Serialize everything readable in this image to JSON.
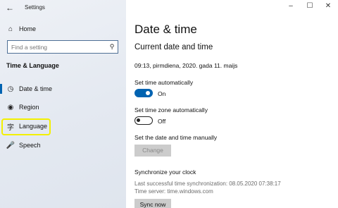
{
  "window": {
    "title": "Settings"
  },
  "sidebar": {
    "home": "Home",
    "search_placeholder": "Find a setting",
    "section_title": "Time & Language",
    "items": [
      {
        "label": "Date & time"
      },
      {
        "label": "Region"
      },
      {
        "label": "Language"
      },
      {
        "label": "Speech"
      }
    ]
  },
  "main": {
    "page_title": "Date & time",
    "current_heading": "Current date and time",
    "current_datetime": "09:13, pirmdiena, 2020. gada 11. maijs",
    "set_time_auto_label": "Set time automatically",
    "set_time_auto_state": "On",
    "set_tz_auto_label": "Set time zone automatically",
    "set_tz_auto_state": "Off",
    "manual_label": "Set the date and time manually",
    "change_button": "Change",
    "sync_heading": "Synchronize your clock",
    "last_sync": "Last successful time synchronization: 08.05.2020 07:38:17",
    "time_server": "Time server: time.windows.com",
    "sync_button": "Sync now"
  },
  "colors": {
    "accent": "#0063b1",
    "highlight": "#f3f000"
  }
}
